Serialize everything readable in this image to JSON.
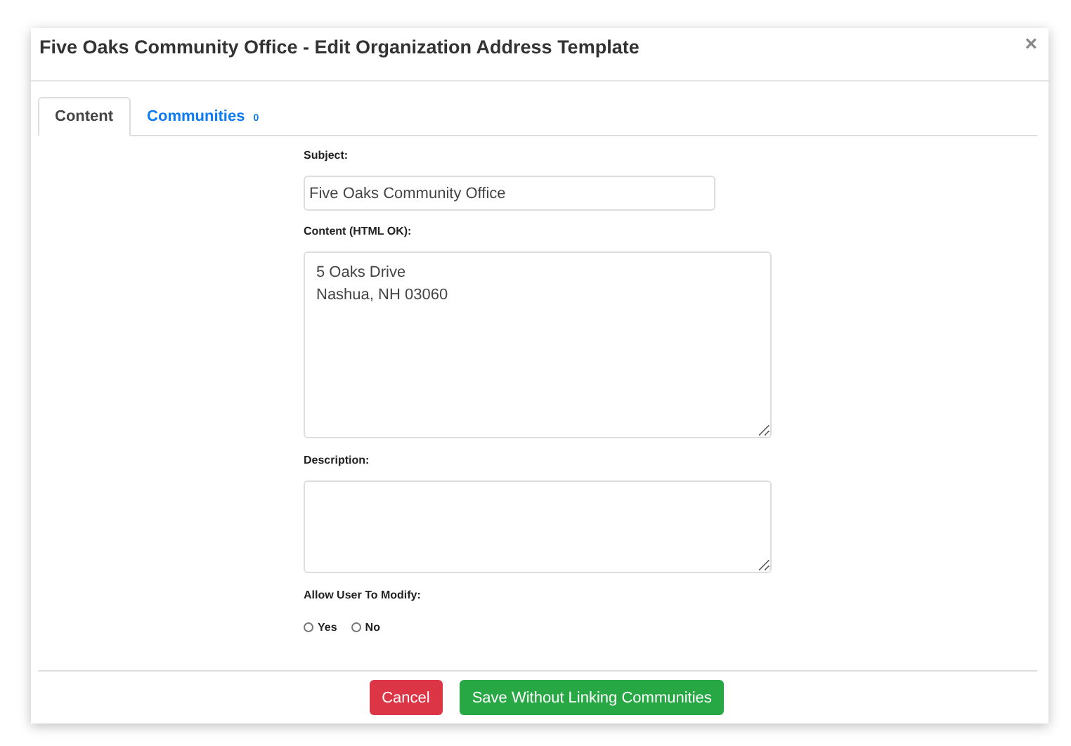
{
  "dialog": {
    "title": "Five Oaks Community Office - Edit Organization Address Template",
    "close": "×"
  },
  "tabs": [
    {
      "label": "Content",
      "selected": true
    },
    {
      "label": "Communities",
      "badge": "0",
      "selected": false
    }
  ],
  "form": {
    "subject": {
      "label": "Subject:",
      "value": "Five Oaks Community Office"
    },
    "content": {
      "label": "Content (HTML OK):",
      "value": "5 Oaks Drive\nNashua, NH 03060"
    },
    "description": {
      "label": "Description:"
    },
    "allow_modify": {
      "label": "Allow User To Modify:",
      "options": [
        {
          "label": "Yes",
          "selected": false
        },
        {
          "label": "No",
          "selected": false
        }
      ]
    }
  },
  "buttons": [
    {
      "label": "Cancel",
      "kind": "danger"
    },
    {
      "label": "Save Without Linking Communities",
      "kind": "success"
    }
  ]
}
